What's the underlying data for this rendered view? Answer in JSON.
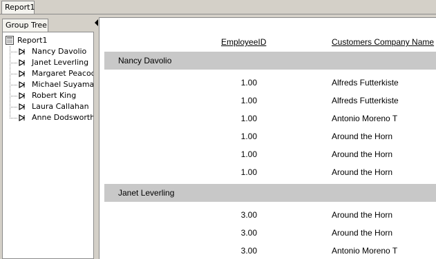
{
  "document_tab": {
    "label": "Report1"
  },
  "group_tree": {
    "tab_label": "Group Tree",
    "root": "Report1",
    "items": [
      {
        "label": "Nancy Davolio"
      },
      {
        "label": "Janet Leverling"
      },
      {
        "label": "Margaret Peacock"
      },
      {
        "label": "Michael Suyama"
      },
      {
        "label": "Robert King"
      },
      {
        "label": "Laura Callahan"
      },
      {
        "label": "Anne Dodsworth"
      }
    ]
  },
  "report": {
    "columns": {
      "employee_id": "EmployeeID",
      "company_name": "Customers Company Name"
    },
    "groups": [
      {
        "name": "Nancy Davolio",
        "rows": [
          {
            "id": "1.00",
            "company": "Alfreds Futterkiste"
          },
          {
            "id": "1.00",
            "company": "Alfreds Futterkiste"
          },
          {
            "id": "1.00",
            "company": "Antonio Moreno T"
          },
          {
            "id": "1.00",
            "company": "Around the Horn"
          },
          {
            "id": "1.00",
            "company": "Around the Horn"
          },
          {
            "id": "1.00",
            "company": "Around the Horn"
          }
        ]
      },
      {
        "name": "Janet Leverling",
        "rows": [
          {
            "id": "3.00",
            "company": "Around the Horn"
          },
          {
            "id": "3.00",
            "company": "Around the Horn"
          },
          {
            "id": "3.00",
            "company": "Antonio Moreno T"
          }
        ]
      }
    ]
  },
  "icons": {
    "root": "report-icon",
    "item": "arrow-node-icon",
    "splitter": "collapse-arrow-icon"
  }
}
